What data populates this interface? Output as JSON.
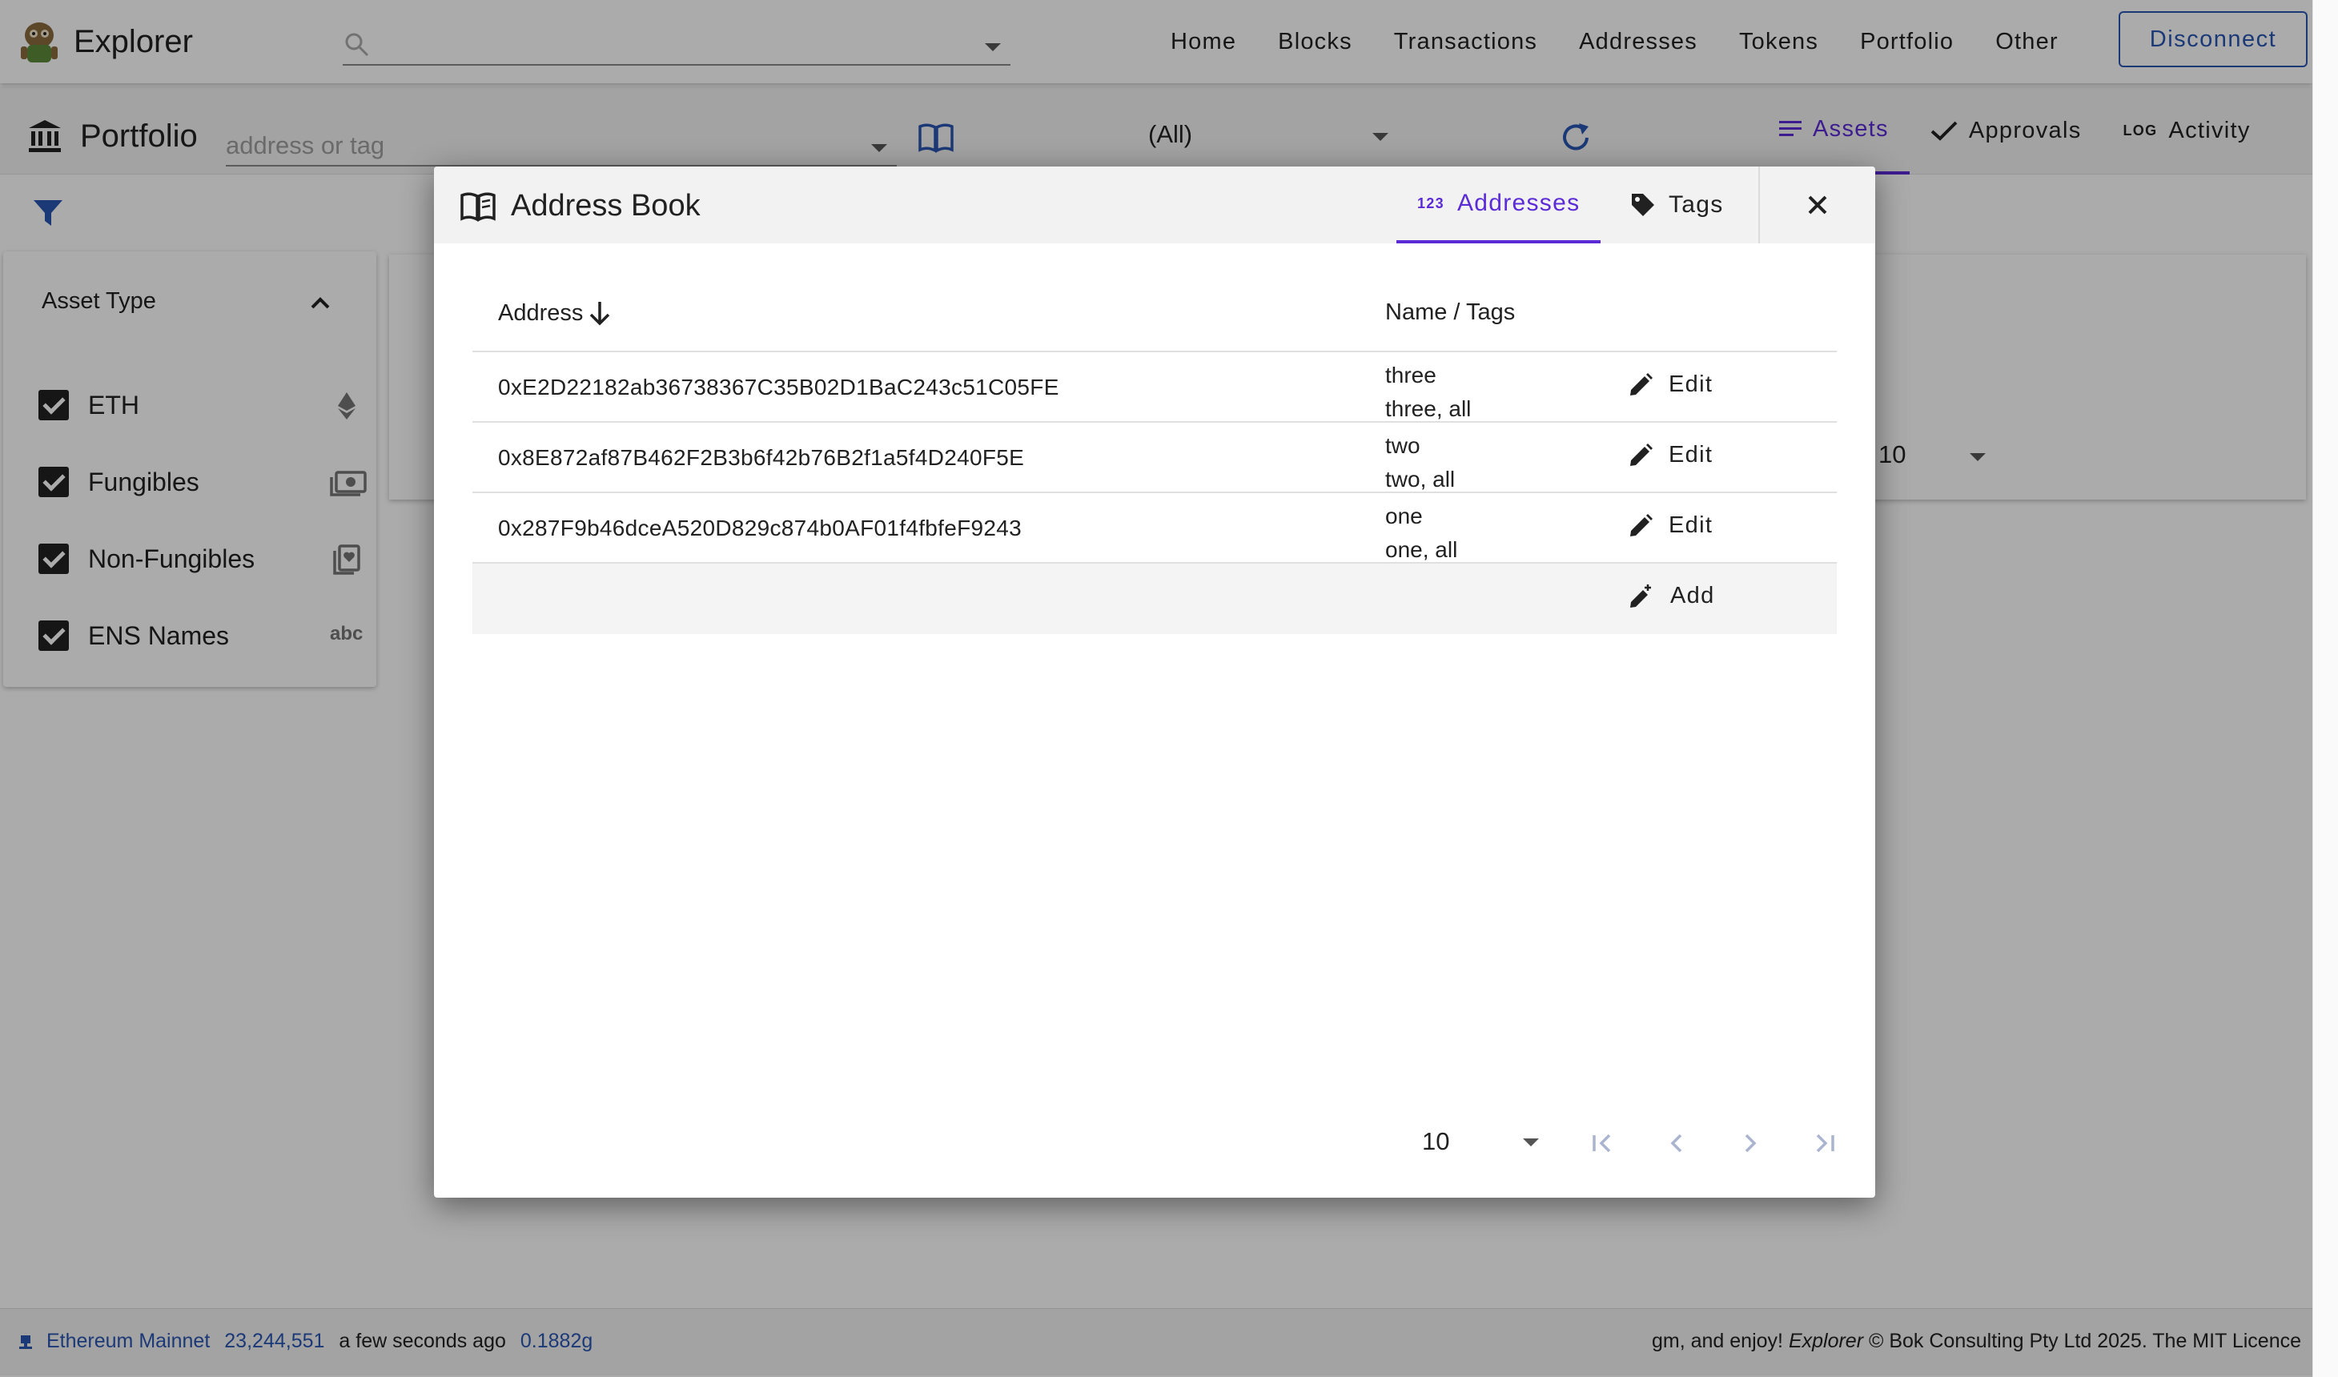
{
  "app": {
    "title": "Explorer"
  },
  "nav": {
    "items": [
      "Home",
      "Blocks",
      "Transactions",
      "Addresses",
      "Tokens",
      "Portfolio",
      "Other"
    ],
    "disconnect_label": "Disconnect"
  },
  "portfolio": {
    "title": "Portfolio",
    "address_placeholder": "address or tag",
    "filter_value": "(All)",
    "tabs": [
      {
        "label": "Assets",
        "icon": "list-icon",
        "active": true
      },
      {
        "label": "Approvals",
        "icon": "check-icon",
        "active": false
      },
      {
        "label": "Activity",
        "icon": "log-icon",
        "active": false
      }
    ],
    "page_size": "10"
  },
  "asset_filter": {
    "header": "Asset Type",
    "items": [
      {
        "label": "ETH",
        "checked": true,
        "icon": "ethereum-icon"
      },
      {
        "label": "Fungibles",
        "checked": true,
        "icon": "money-icon"
      },
      {
        "label": "Non-Fungibles",
        "checked": true,
        "icon": "collection-icon"
      },
      {
        "label": "ENS Names",
        "checked": true,
        "icon": "abc-icon"
      }
    ]
  },
  "dialog": {
    "title": "Address Book",
    "tabs": [
      {
        "label": "Addresses",
        "badge": "123",
        "active": true
      },
      {
        "label": "Tags",
        "active": false
      }
    ],
    "columns": {
      "address": "Address",
      "name": "Name / Tags"
    },
    "rows": [
      {
        "address": "0xE2D22182ab36738367C35B02D1BaC243c51C05FE",
        "name": "three",
        "tags": "three, all"
      },
      {
        "address": "0x8E872af87B462F2B3b6f42b76B2f1a5f4D240F5E",
        "name": "two",
        "tags": "two, all"
      },
      {
        "address": "0x287F9b46dceA520D829c874b0AF01f4fbfeF9243",
        "name": "one",
        "tags": "one, all"
      }
    ],
    "edit_label": "Edit",
    "add_label": "Add",
    "page_size": "10"
  },
  "footer": {
    "network": "Ethereum Mainnet",
    "block": "23,244,551",
    "time_ago": "a few seconds ago",
    "gas": "0.1882g",
    "credit_prefix": "gm, and enjoy!",
    "credit_app": "Explorer",
    "credit_suffix": "© Bok Consulting Pty Ltd 2025. The MIT Licence"
  },
  "colors": {
    "accent": "#5b2bd6",
    "link": "#2a56b2",
    "pager_disabled": "#aab4cf"
  }
}
